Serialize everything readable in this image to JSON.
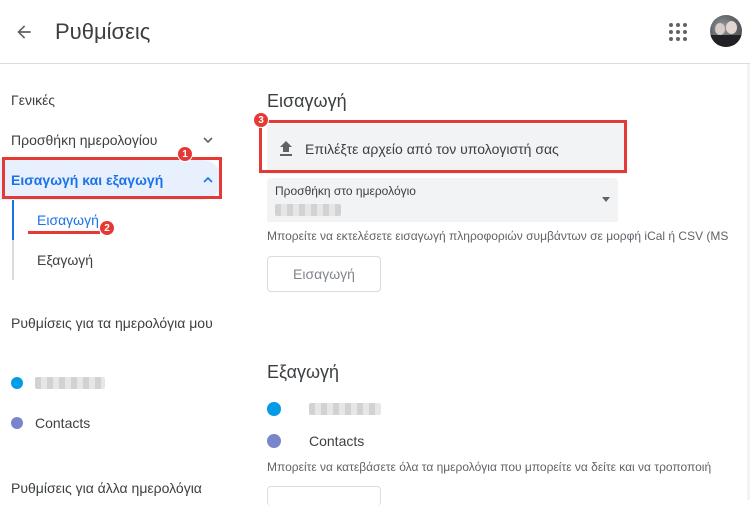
{
  "header": {
    "title": "Ρυθμίσεις",
    "back_icon": "arrow-back-icon",
    "apps_icon": "apps-grid-icon"
  },
  "sidebar": {
    "items": [
      {
        "label": "Γενικές"
      },
      {
        "label": "Προσθήκη ημερολογίου"
      },
      {
        "label": "Εισαγωγή και εξαγωγή"
      }
    ],
    "subitems": [
      {
        "label": "Εισαγωγή"
      },
      {
        "label": "Εξαγωγή"
      }
    ],
    "my_calendars_label": "Ρυθμίσεις για τα ημερολόγια μου",
    "my_calendars": [
      {
        "label": "",
        "color": "#039be5"
      },
      {
        "label": "Contacts",
        "color": "#7986cb"
      }
    ],
    "other_calendars_label": "Ρυθμίσεις για άλλα ημερολόγια"
  },
  "import_section": {
    "title": "Εισαγωγή",
    "upload_label": "Επιλέξτε αρχείο από τον υπολογιστή σας",
    "calendar_select_label": "Προσθήκη στο ημερολόγιο",
    "help": "Μπορείτε να εκτελέσετε εισαγωγή πληροφοριών συμβάντων σε μορφή iCal ή CSV (MS",
    "button_label": "Εισαγωγή"
  },
  "export_section": {
    "title": "Εξαγωγή",
    "calendars": [
      {
        "label": "",
        "color": "#039be5"
      },
      {
        "label": "Contacts",
        "color": "#7986cb"
      }
    ],
    "help": "Μπορείτε να κατεβάσετε όλα τα ημερολόγια που μπορείτε να δείτε και να τροποποιή"
  },
  "annotations": {
    "badge_1": "1",
    "badge_2": "2",
    "badge_3": "3"
  },
  "colors": {
    "accent": "#1a73e8",
    "annotation": "#e53935"
  }
}
